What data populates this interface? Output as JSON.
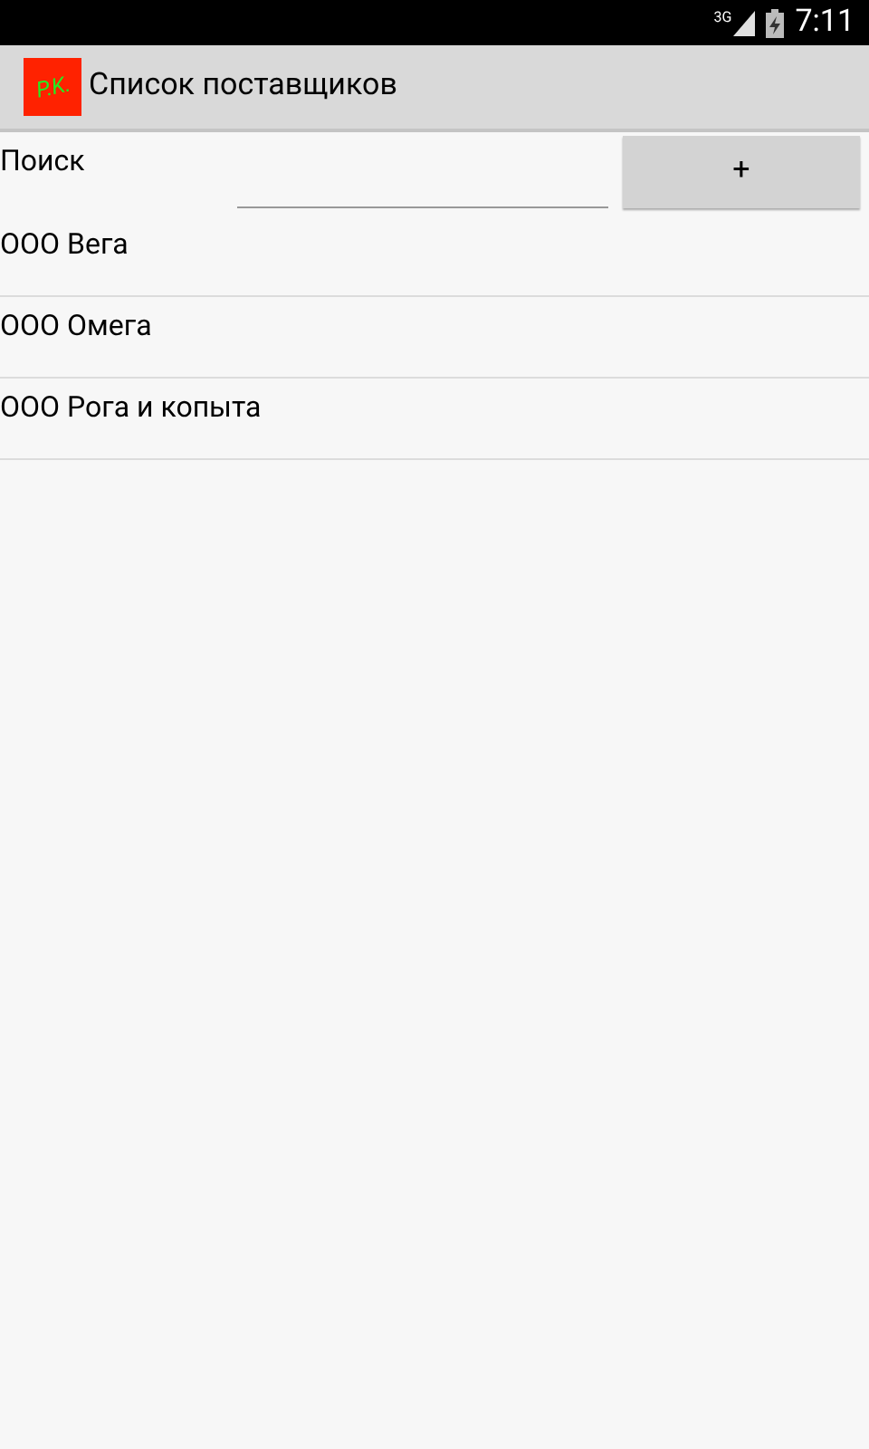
{
  "status_bar": {
    "network": "3G",
    "time": "7:11"
  },
  "action_bar": {
    "logo_text": "P.K.",
    "title": "Список поставщиков"
  },
  "search": {
    "label": "Поиск"
  },
  "add_button": {
    "label": "+"
  },
  "suppliers": [
    {
      "name": "ООО Вега"
    },
    {
      "name": "ООО Омега"
    },
    {
      "name": "ООО Рога и копыта"
    }
  ]
}
